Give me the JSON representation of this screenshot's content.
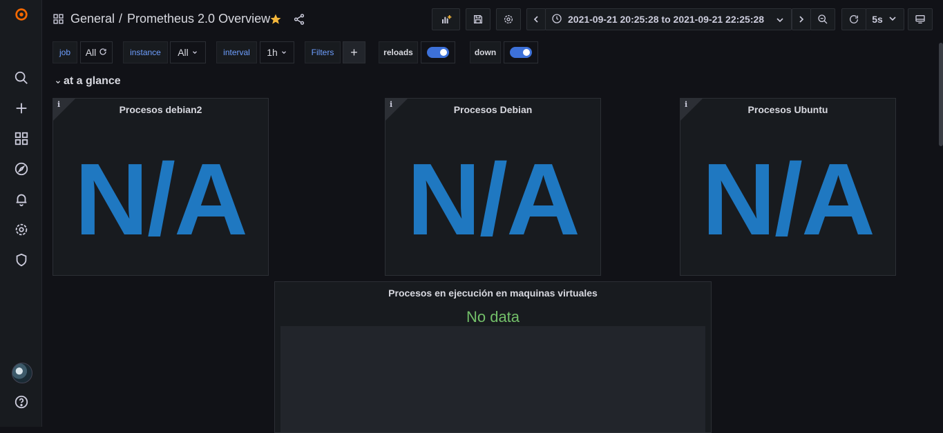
{
  "sidebar": {
    "items": [
      {
        "icon": "grafana-logo-icon"
      },
      {
        "icon": "search-icon"
      },
      {
        "icon": "plus-icon"
      },
      {
        "icon": "dashboards-icon"
      },
      {
        "icon": "explore-compass-icon"
      },
      {
        "icon": "alerting-bell-icon"
      },
      {
        "icon": "configuration-gear-icon"
      },
      {
        "icon": "server-admin-shield-icon"
      },
      {
        "icon": "user-avatar"
      },
      {
        "icon": "help-icon"
      }
    ]
  },
  "header": {
    "folder": "General",
    "separator": "/",
    "title": "Prometheus 2.0 Overview",
    "time_range": "2021-09-21 20:25:28 to 2021-09-21 22:25:28",
    "refresh_interval": "5s"
  },
  "variables": {
    "job_label": "job",
    "job_value": "All",
    "instance_label": "instance",
    "instance_value": "All",
    "interval_label": "interval",
    "interval_value": "1h",
    "filters_label": "Filters",
    "add_filter": "+",
    "reloads_label": "reloads",
    "down_label": "down"
  },
  "row": {
    "title": "at a glance"
  },
  "panels": [
    {
      "title": "Procesos debian2",
      "value": "N/A"
    },
    {
      "title": "Procesos Debian",
      "value": "N/A"
    },
    {
      "title": "Procesos Ubuntu",
      "value": "N/A"
    },
    {
      "title": "Procesos en ejecución en maquinas virtuales",
      "message": "No data"
    }
  ],
  "colors": {
    "stat_value": "#1f78c1",
    "no_data": "#73bf69",
    "accent": "#3d71d9",
    "star": "#f5b73b",
    "logo": "#f46800"
  }
}
